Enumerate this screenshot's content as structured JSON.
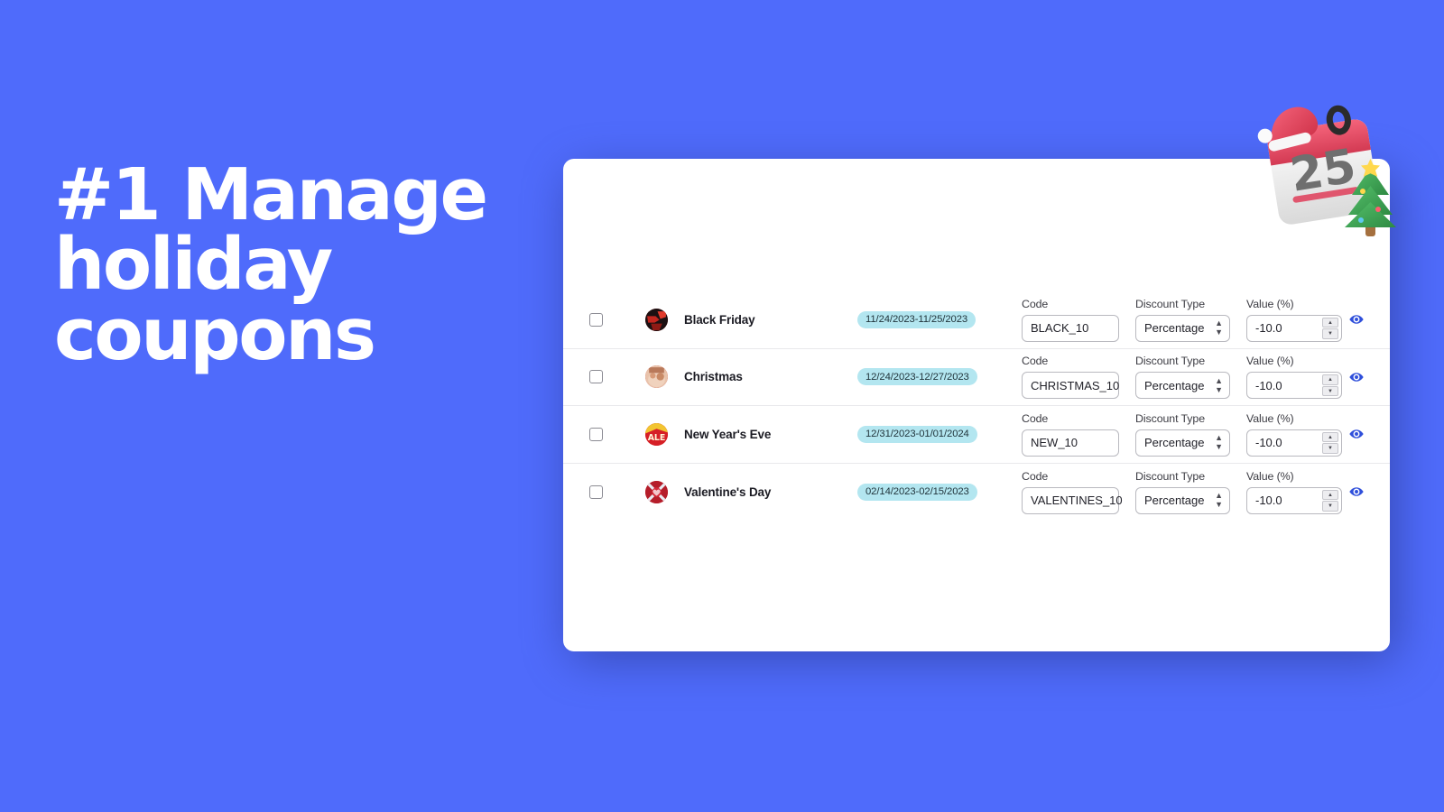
{
  "background_color": "#4f6bfb",
  "headline": {
    "line1": "#1 Manage",
    "line2": "holiday",
    "line3": "coupons",
    "color": "#ffffff"
  },
  "decoration": {
    "name": "santa-calendar-illustration",
    "calendar_day": "25",
    "hat_color": "#e8465c",
    "tree_color": "#3aa84f"
  },
  "card": {
    "background_color": "#ffffff",
    "accent_color": "#2f4fdb",
    "badge_background": "#b3e6f0",
    "rows": [
      {
        "name": "Black Friday",
        "date_range": "11/24/2023-11/25/2023",
        "code_label": "Code",
        "code_value": "BLACK_10",
        "discount_type_label": "Discount Type",
        "discount_type_value": "Percentage",
        "value_label": "Value (%)",
        "value_value": "-10.0",
        "checkbox_checked": false,
        "avatar": "black-friday-thumbnail",
        "action_icon": "eye-icon"
      },
      {
        "name": "Christmas",
        "date_range": "12/24/2023-12/27/2023",
        "code_label": "Code",
        "code_value": "CHRISTMAS_10",
        "discount_type_label": "Discount Type",
        "discount_type_value": "Percentage",
        "value_label": "Value (%)",
        "value_value": "-10.0",
        "checkbox_checked": false,
        "avatar": "christmas-thumbnail",
        "action_icon": "eye-icon"
      },
      {
        "name": "New Year's Eve",
        "date_range": "12/31/2023-01/01/2024",
        "code_label": "Code",
        "code_value": "NEW_10",
        "discount_type_label": "Discount Type",
        "discount_type_value": "Percentage",
        "value_label": "Value (%)",
        "value_value": "-10.0",
        "checkbox_checked": false,
        "avatar": "new-years-eve-thumbnail",
        "action_icon": "eye-icon"
      },
      {
        "name": "Valentine's Day",
        "date_range": "02/14/2023-02/15/2023",
        "code_label": "Code",
        "code_value": "VALENTINES_10",
        "discount_type_label": "Discount Type",
        "discount_type_value": "Percentage",
        "value_label": "Value (%)",
        "value_value": "-10.0",
        "checkbox_checked": false,
        "avatar": "valentines-day-thumbnail",
        "action_icon": "eye-icon"
      }
    ],
    "spinner": {
      "up": "▲",
      "down": "▼"
    },
    "select_chevron": "chevron-up-down-icon"
  }
}
